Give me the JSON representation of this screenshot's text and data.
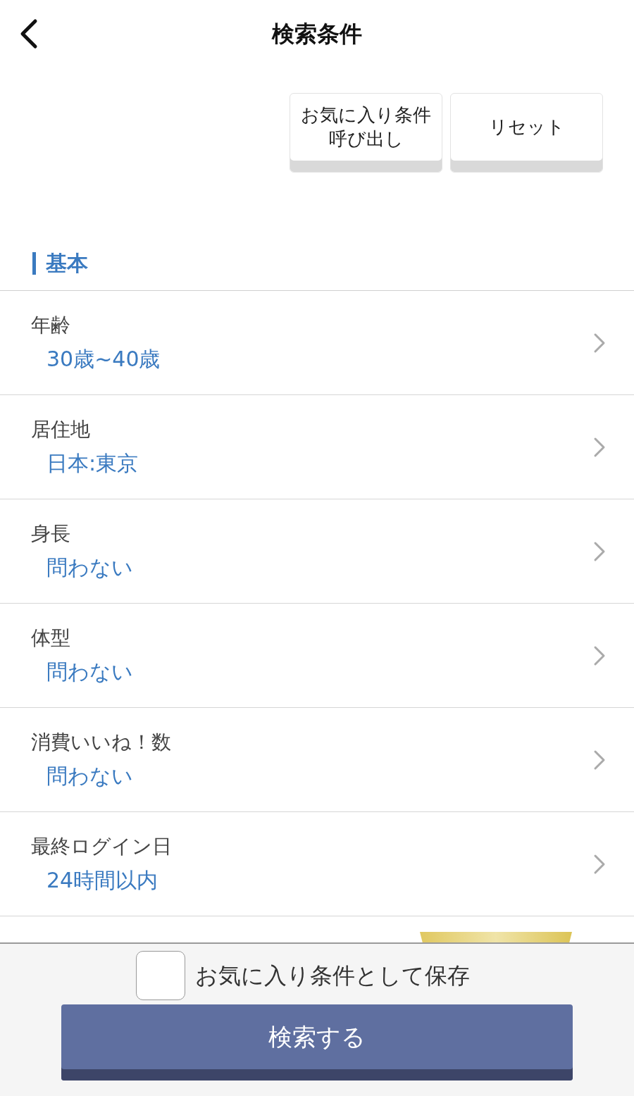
{
  "header": {
    "title": "検索条件"
  },
  "actions": [
    {
      "label": "お気に入り条件呼び出し"
    },
    {
      "label": "リセット"
    }
  ],
  "section": {
    "title": "基本"
  },
  "rows": [
    {
      "kind": "item",
      "label": "年齢",
      "value": "30歳~40歳"
    },
    {
      "kind": "item",
      "label": "居住地",
      "value": "日本:東京"
    },
    {
      "kind": "item",
      "label": "身長",
      "value": "問わない"
    },
    {
      "kind": "item",
      "label": "体型",
      "value": "問わない"
    },
    {
      "kind": "item",
      "label": "消費いいね！数",
      "value": "問わない"
    },
    {
      "kind": "item",
      "label": "最終ログイン日",
      "value": "24時間以内"
    },
    {
      "kind": "cut"
    }
  ],
  "footer": {
    "save_label": "お気に入り条件として保存",
    "save_checked": false,
    "search_button": "検索する"
  }
}
